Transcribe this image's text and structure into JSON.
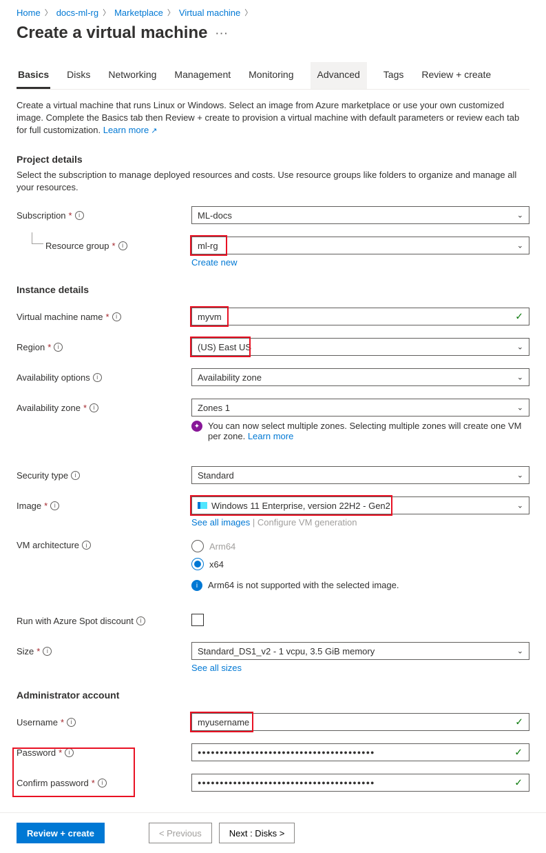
{
  "breadcrumb": {
    "home": "Home",
    "rg": "docs-ml-rg",
    "market": "Marketplace",
    "vm": "Virtual machine"
  },
  "title": "Create a virtual machine",
  "tabs": {
    "basics": "Basics",
    "disks": "Disks",
    "networking": "Networking",
    "management": "Management",
    "monitoring": "Monitoring",
    "advanced": "Advanced",
    "tags": "Tags",
    "review": "Review + create"
  },
  "intro": "Create a virtual machine that runs Linux or Windows. Select an image from Azure marketplace or use your own customized image. Complete the Basics tab then Review + create to provision a virtual machine with default parameters or review each tab for full customization. ",
  "learn_more": "Learn more",
  "project": {
    "heading": "Project details",
    "desc": "Select the subscription to manage deployed resources and costs. Use resource groups like folders to organize and manage all your resources.",
    "sub_label": "Subscription",
    "sub_value": "ML-docs",
    "rg_label": "Resource group",
    "rg_value": "ml-rg",
    "create_new": "Create new"
  },
  "instance": {
    "heading": "Instance details",
    "vmname_label": "Virtual machine name",
    "vmname_value": "myvm",
    "region_label": "Region",
    "region_value": "(US) East US",
    "avail_label": "Availability options",
    "avail_value": "Availability zone",
    "zone_label": "Availability zone",
    "zone_value": "Zones 1",
    "zone_hint": "You can now select multiple zones. Selecting multiple zones will create one VM per zone. ",
    "sectype_label": "Security type",
    "sectype_value": "Standard",
    "image_label": "Image",
    "image_value": "Windows 11 Enterprise, version 22H2 - Gen2",
    "see_images": "See all images",
    "config_gen": "Configure VM generation",
    "arch_label": "VM architecture",
    "arm64": "Arm64",
    "x64": "x64",
    "arm_hint": "Arm64 is not supported with the selected image.",
    "spot_label": "Run with Azure Spot discount",
    "size_label": "Size",
    "size_value": "Standard_DS1_v2 - 1 vcpu, 3.5 GiB memory",
    "see_sizes": "See all sizes"
  },
  "admin": {
    "heading": "Administrator account",
    "user_label": "Username",
    "user_value": "myusername",
    "pass_label": "Password",
    "pass_value": "●●●●●●●●●●●●●●●●●●●●●●●●●●●●●●●●●●●●●●●●",
    "confirm_label": "Confirm password"
  },
  "footer": {
    "review": "Review + create",
    "prev": "< Previous",
    "next": "Next : Disks >"
  }
}
